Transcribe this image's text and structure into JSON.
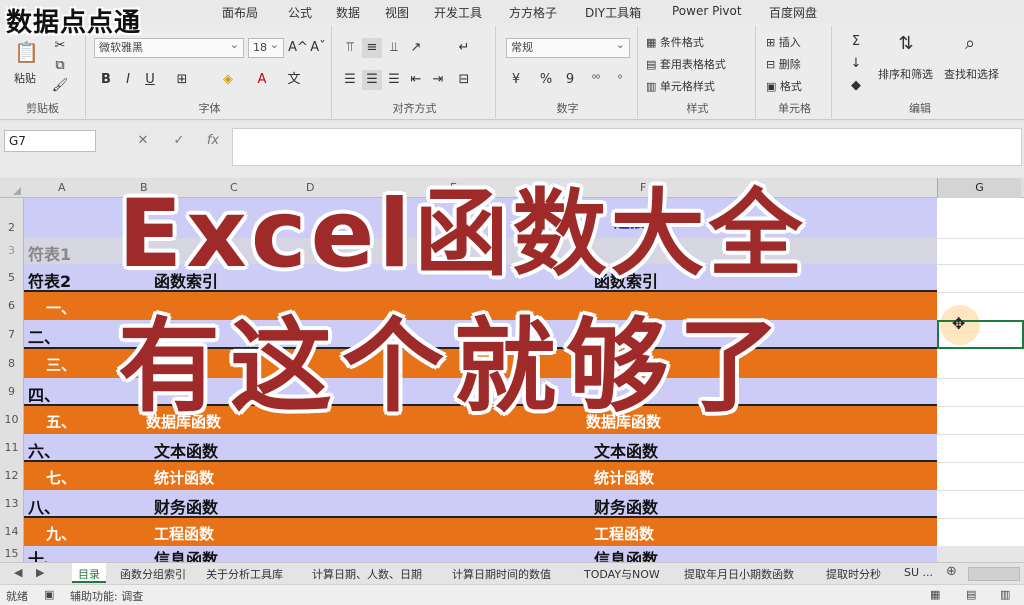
{
  "watermark": "数据点点通",
  "menu": {
    "tabs": [
      "面布局",
      "公式",
      "数据",
      "视图",
      "开发工具",
      "方方格子",
      "DIY工具箱",
      "Power Pivot",
      "百度网盘"
    ]
  },
  "ribbon": {
    "clipboard": {
      "paste": "粘贴",
      "label": "剪贴板"
    },
    "font": {
      "name": "微软雅黑",
      "size": "18",
      "grow": "A^",
      "shrink": "Aˇ",
      "bold": "B",
      "italic": "I",
      "underline": "U",
      "label": "字体"
    },
    "align": {
      "label": "对齐方式"
    },
    "number": {
      "format": "常规",
      "percent": "%",
      "comma": "9",
      "label": "数字"
    },
    "styles": {
      "cond": "条件格式",
      "table": "套用表格格式",
      "cell": "单元格样式",
      "label": "样式"
    },
    "cells": {
      "insert": "插入",
      "delete": "删除",
      "format": "格式",
      "label": "单元格"
    },
    "editing": {
      "sort": "排序和筛选",
      "find": "查找和选择",
      "label": "编辑"
    }
  },
  "formula_bar": {
    "name_box": "G7",
    "cancel": "✕",
    "enter": "✓",
    "fx": "fx",
    "content": ""
  },
  "grid": {
    "columns": [
      "A",
      "B",
      "C",
      "D",
      "E",
      "F",
      "G"
    ],
    "rows": [
      {
        "num": "2",
        "left": "",
        "right": "连接"
      },
      {
        "num": "3",
        "left": "符表1",
        "right": ""
      },
      {
        "num": "5",
        "left": "符表2",
        "mid": "函数索引",
        "right": "函数索引"
      },
      {
        "num": "6",
        "left": "一、",
        "mid": "",
        "right": ""
      },
      {
        "num": "7",
        "left": "二、",
        "mid": "",
        "right": ""
      },
      {
        "num": "8",
        "left": "三、",
        "mid": "",
        "right": ""
      },
      {
        "num": "9",
        "left": "四、",
        "mid": "",
        "right": ""
      },
      {
        "num": "10",
        "left": "五、",
        "mid": "数据库函数",
        "right": "数据库函数"
      },
      {
        "num": "11",
        "left": "六、",
        "mid": "文本函数",
        "right": "文本函数"
      },
      {
        "num": "12",
        "left": "七、",
        "mid": "统计函数",
        "right": "统计函数"
      },
      {
        "num": "13",
        "left": "八、",
        "mid": "财务函数",
        "right": "财务函数"
      },
      {
        "num": "14",
        "left": "九、",
        "mid": "工程函数",
        "right": "工程函数"
      },
      {
        "num": "15",
        "left": "十、",
        "mid": "信息函数",
        "right": "信息函数"
      }
    ]
  },
  "overlay": {
    "line1": "Excel函数大全",
    "line2": "有这个就够了"
  },
  "sheet_tabs": [
    "目录",
    "函数分组索引",
    "关于分析工具库",
    "计算日期、人数、日期",
    "计算日期时间的数值",
    "TODAY与NOW",
    "提取年月日小期数函数",
    "提取时分秒",
    "SU ..."
  ],
  "status": {
    "ready": "就绪",
    "accessibility": "辅助功能: 调查"
  },
  "colors": {
    "lavender": "#ccccf7",
    "orange": "#e77218",
    "title": "#9e2a2a",
    "accent": "#1f7a3d"
  }
}
